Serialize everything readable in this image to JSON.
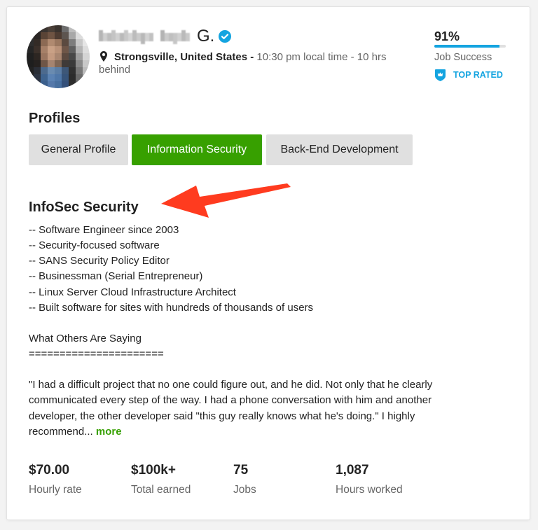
{
  "profile": {
    "name_visible": "G.",
    "location": "Strongsville, United States",
    "location_separator": "-",
    "local_time": "10:30 pm local time - 10 hrs behind"
  },
  "job_success": {
    "value": "91%",
    "percent": 91,
    "label": "Job Success"
  },
  "badge": {
    "label": "TOP RATED"
  },
  "profiles": {
    "heading": "Profiles",
    "tabs": [
      {
        "label": "General Profile",
        "active": false
      },
      {
        "label": "Information Security",
        "active": true
      },
      {
        "label": "Back-End Development",
        "active": false
      }
    ]
  },
  "specialized_profile": {
    "title": "InfoSec Security",
    "bullets": [
      "-- Software Engineer since 2003",
      "-- Security-focused software",
      "-- SANS Security Policy Editor",
      "-- Businessman (Serial Entrepreneur)",
      "-- Linux Server Cloud Infrastructure Architect",
      "-- Built software for sites with hundreds of thousands of users"
    ],
    "testimonials_heading": "What Others Are Saying",
    "separator": "======================",
    "quote_lines": [
      "\"I had a difficult project that no one could figure out, and he did. Not only that he clearly",
      "communicated every step of the way. I had a phone conversation with him and another",
      "developer, the other developer said \"this guy really knows what he's doing.\" I highly",
      "recommend..."
    ],
    "more_link": "more"
  },
  "stats": [
    {
      "value": "$70.00",
      "label": "Hourly rate"
    },
    {
      "value": "$100k+",
      "label": "Total earned"
    },
    {
      "value": "75",
      "label": "Jobs"
    },
    {
      "value": "1,087",
      "label": "Hours worked"
    }
  ],
  "icons": {
    "verified": "verified-badge-icon",
    "location": "map-pin-icon",
    "top_rated": "top-rated-shield-icon"
  },
  "colors": {
    "accent_green": "#37a000",
    "accent_blue": "#14a4e0",
    "text": "#222222",
    "muted_text": "#656565",
    "tab_background": "#e0e0e0",
    "annotation_arrow": "#ff3b1f"
  }
}
